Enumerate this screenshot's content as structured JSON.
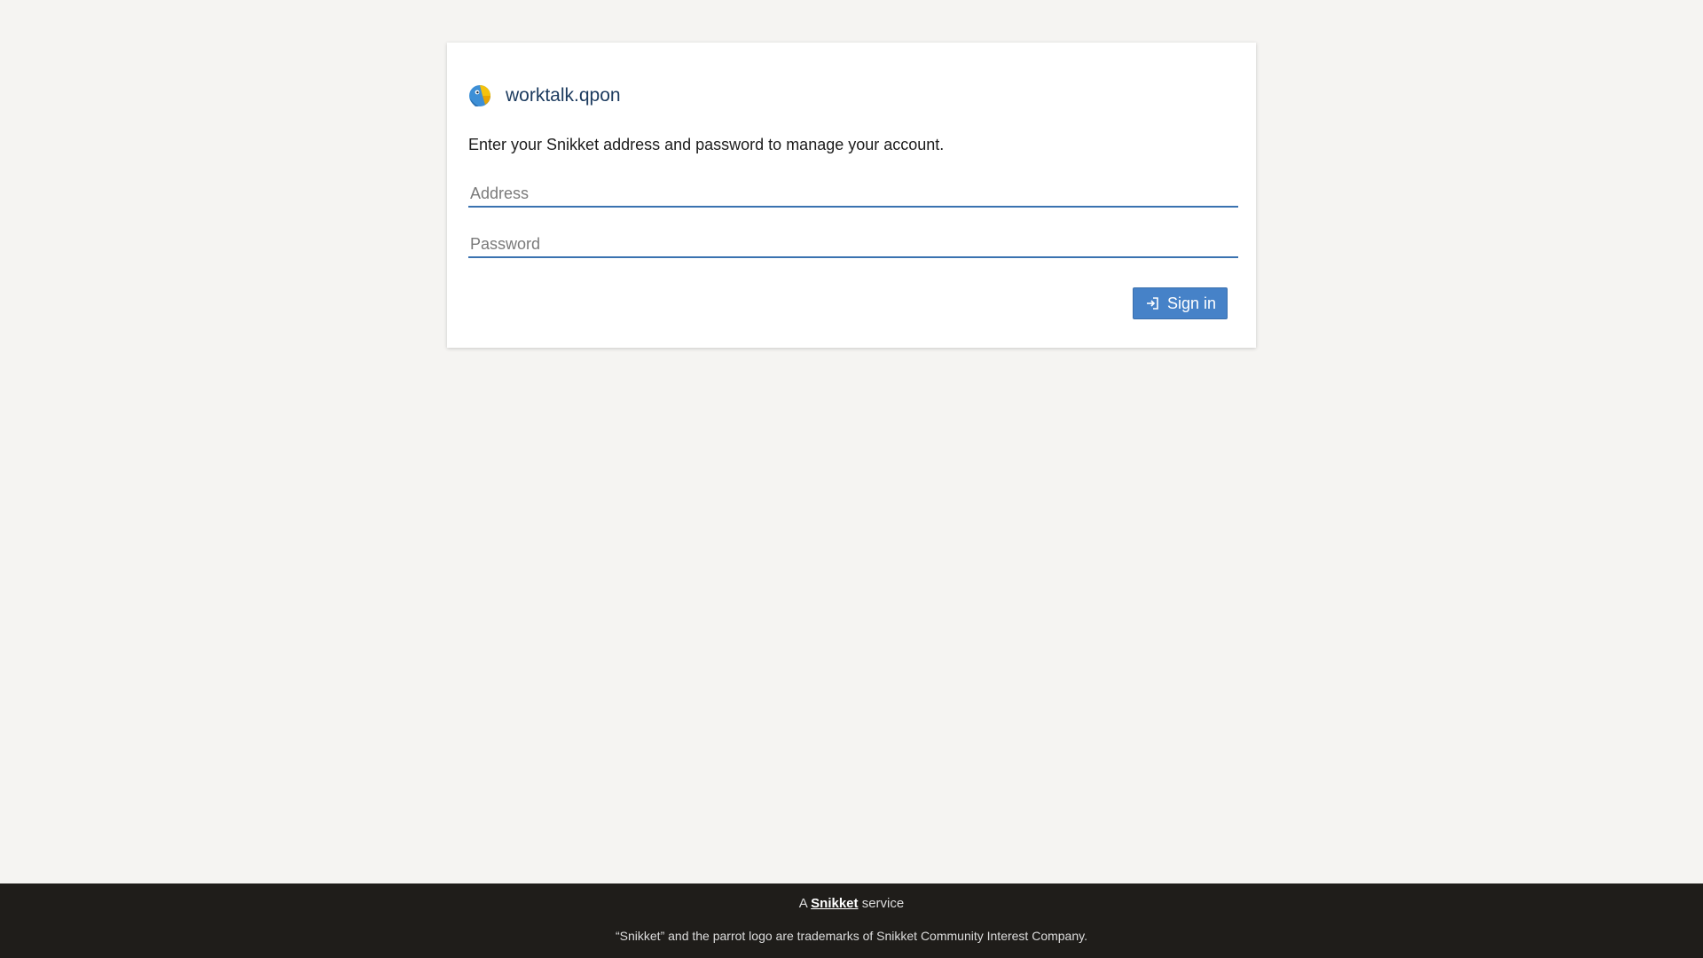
{
  "site": {
    "domain": "worktalk.qpon",
    "logo_icon": "parrot-logo-icon"
  },
  "login": {
    "intro": "Enter your Snikket address and password to manage your account.",
    "address_placeholder": "Address",
    "address_value": "",
    "password_placeholder": "Password",
    "password_value": "",
    "signin_label": "Sign in",
    "signin_icon": "sign-in-icon"
  },
  "footer": {
    "service_prefix": "A",
    "service_link": "Snikket",
    "service_suffix": "service",
    "trademark": "“Snikket” and the parrot logo are trademarks of Snikket Community Interest Company."
  },
  "colors": {
    "background": "#f5f4f2",
    "accent": "#4682c8",
    "footer_bg": "#1f1d1a",
    "domain_text": "#1b3a5e"
  }
}
